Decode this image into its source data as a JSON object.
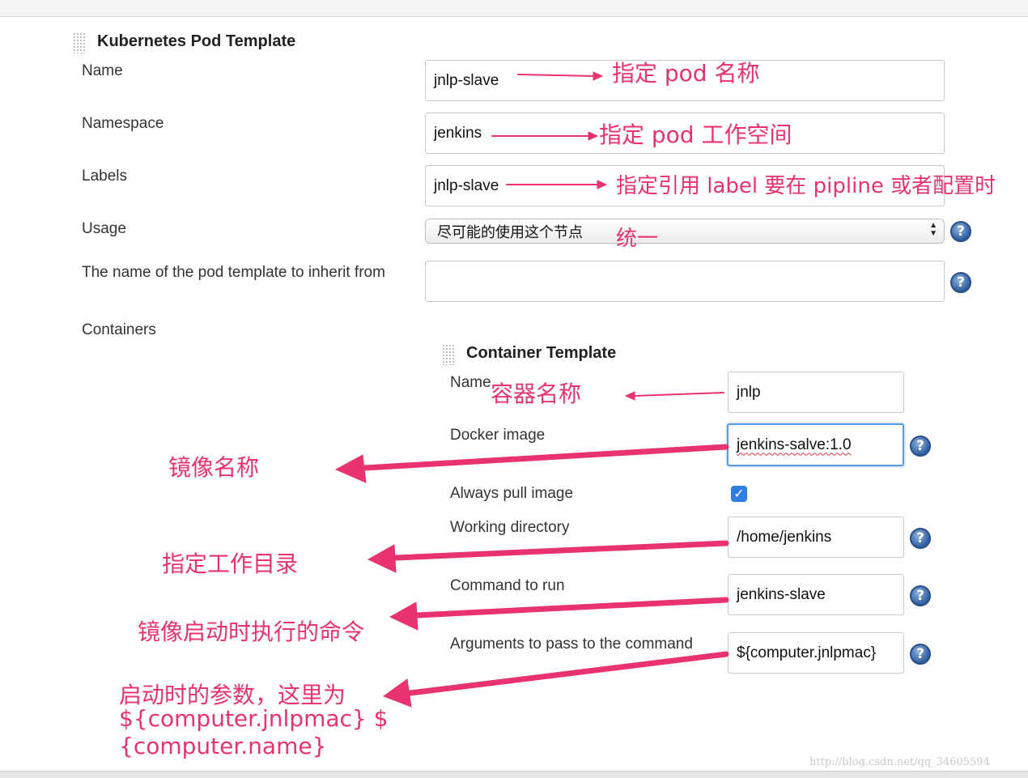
{
  "pod_template": {
    "title": "Kubernetes Pod Template",
    "name_label": "Name",
    "name_value": "jnlp-slave",
    "namespace_label": "Namespace",
    "namespace_value": "jenkins",
    "labels_label": "Labels",
    "labels_value": "jnlp-slave",
    "usage_label": "Usage",
    "usage_value": "尽可能的使用这个节点",
    "inherit_label": "The name of the pod template to inherit from",
    "inherit_value": "",
    "containers_label": "Containers"
  },
  "container_template": {
    "title": "Container Template",
    "name_label": "Name",
    "name_value": "jnlp",
    "docker_image_label": "Docker image",
    "docker_image_value": "jenkins-salve:1.0",
    "always_pull_label": "Always pull image",
    "always_pull_checked": true,
    "working_dir_label": "Working directory",
    "working_dir_value": "/home/jenkins",
    "command_label": "Command to run",
    "command_value": "jenkins-slave",
    "args_label": "Arguments to pass to the command",
    "args_value": "${computer.jnlpmac}"
  },
  "help_icon": {
    "glyph": "?",
    "icon": "question-circle-icon",
    "color": "#2f5f9f"
  },
  "annotations": {
    "color": "#e8336f",
    "pod_name": "指定 pod 名称",
    "pod_namespace": "指定 pod 工作空间",
    "labels_line1": "指定引用 label 要在 pipline 或者配置时",
    "labels_line2": "统一",
    "container_name": "容器名称",
    "image_name": "镜像名称",
    "work_dir": "指定工作目录",
    "command": "镜像启动时执行的命令",
    "args_line1": "启动时的参数，这里为",
    "args_line2": "${computer.jnlpmac} $",
    "args_line3": "{computer.name}"
  },
  "watermark": "http://blog.csdn.net/qq_34605594"
}
